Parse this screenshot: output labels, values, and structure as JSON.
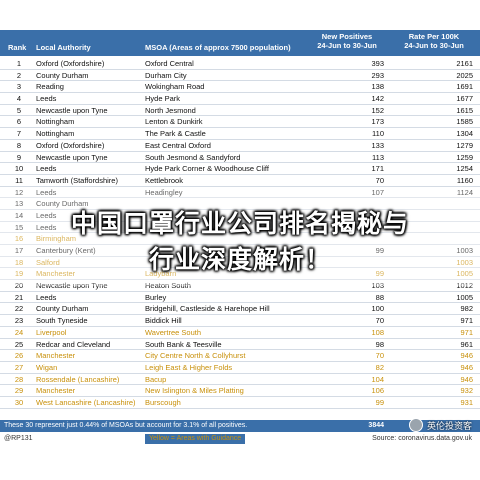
{
  "header": {
    "rank": "Rank",
    "local_authority": "Local Authority",
    "msoa": "MSOA (Areas of approx 7500 population)",
    "new_positives": "New Positives",
    "new_positives_sub": "24-Jun to 30-Jun",
    "rate": "Rate Per 100K",
    "rate_sub": "24-Jun to 30-Jun"
  },
  "rows": [
    {
      "rank": "1",
      "la": "Oxford (Oxfordshire)",
      "msoa": "Oxford Central",
      "np": "393",
      "rate": "2161",
      "style": "normal"
    },
    {
      "rank": "2",
      "la": "County Durham",
      "msoa": "Durham City",
      "np": "293",
      "rate": "2025",
      "style": "normal"
    },
    {
      "rank": "3",
      "la": "Reading",
      "msoa": "Wokingham Road",
      "np": "138",
      "rate": "1691",
      "style": "normal"
    },
    {
      "rank": "4",
      "la": "Leeds",
      "msoa": "Hyde Park",
      "np": "142",
      "rate": "1677",
      "style": "normal"
    },
    {
      "rank": "5",
      "la": "Newcastle upon Tyne",
      "msoa": "North Jesmond",
      "np": "152",
      "rate": "1615",
      "style": "normal"
    },
    {
      "rank": "6",
      "la": "Nottingham",
      "msoa": "Lenton & Dunkirk",
      "np": "173",
      "rate": "1585",
      "style": "normal"
    },
    {
      "rank": "7",
      "la": "Nottingham",
      "msoa": "The Park & Castle",
      "np": "110",
      "rate": "1304",
      "style": "normal"
    },
    {
      "rank": "8",
      "la": "Oxford (Oxfordshire)",
      "msoa": "East Central Oxford",
      "np": "133",
      "rate": "1279",
      "style": "normal"
    },
    {
      "rank": "9",
      "la": "Newcastle upon Tyne",
      "msoa": "South Jesmond & Sandyford",
      "np": "113",
      "rate": "1259",
      "style": "normal"
    },
    {
      "rank": "10",
      "la": "Leeds",
      "msoa": "Hyde Park Corner & Woodhouse Cliff",
      "np": "171",
      "rate": "1254",
      "style": "normal"
    },
    {
      "rank": "11",
      "la": "Tamworth (Staffordshire)",
      "msoa": "Kettlebrook",
      "np": "70",
      "rate": "1160",
      "style": "normal"
    },
    {
      "rank": "12",
      "la": "Leeds",
      "msoa": "Headingley",
      "np": "107",
      "rate": "1124",
      "style": "normal"
    },
    {
      "rank": "13",
      "la": "County Durham",
      "msoa": "",
      "np": "",
      "rate": "",
      "style": "normal"
    },
    {
      "rank": "14",
      "la": "Leeds",
      "msoa": "",
      "np": "",
      "rate": "",
      "style": "normal"
    },
    {
      "rank": "15",
      "la": "Leeds",
      "msoa": "",
      "np": "",
      "rate": "",
      "style": "normal"
    },
    {
      "rank": "16",
      "la": "Birmingham",
      "msoa": "",
      "np": "",
      "rate": "",
      "style": "yellow"
    },
    {
      "rank": "17",
      "la": "Canterbury (Kent)",
      "msoa": "",
      "np": "99",
      "rate": "1003",
      "style": "normal"
    },
    {
      "rank": "18",
      "la": "Salford",
      "msoa": "",
      "np": "",
      "rate": "1003",
      "style": "yellow"
    },
    {
      "rank": "19",
      "la": "Manchester",
      "msoa": "Ladybarn",
      "np": "99",
      "rate": "1005",
      "style": "yellow"
    },
    {
      "rank": "20",
      "la": "Newcastle upon Tyne",
      "msoa": "Heaton South",
      "np": "103",
      "rate": "1012",
      "style": "normal"
    },
    {
      "rank": "21",
      "la": "Leeds",
      "msoa": "Burley",
      "np": "88",
      "rate": "1005",
      "style": "normal"
    },
    {
      "rank": "22",
      "la": "County Durham",
      "msoa": "Bridgehill, Castleside & Harehope Hill",
      "np": "100",
      "rate": "982",
      "style": "normal"
    },
    {
      "rank": "23",
      "la": "South Tyneside",
      "msoa": "Biddick Hill",
      "np": "70",
      "rate": "971",
      "style": "normal"
    },
    {
      "rank": "24",
      "la": "Liverpool",
      "msoa": "Wavertree South",
      "np": "108",
      "rate": "971",
      "style": "yellow"
    },
    {
      "rank": "25",
      "la": "Redcar and Cleveland",
      "msoa": "South Bank & Teesville",
      "np": "98",
      "rate": "961",
      "style": "normal"
    },
    {
      "rank": "26",
      "la": "Manchester",
      "msoa": "City Centre North & Collyhurst",
      "np": "70",
      "rate": "946",
      "style": "yellow"
    },
    {
      "rank": "27",
      "la": "Wigan",
      "msoa": "Leigh East & Higher Folds",
      "np": "82",
      "rate": "946",
      "style": "yellow"
    },
    {
      "rank": "28",
      "la": "Rossendale (Lancashire)",
      "msoa": "Bacup",
      "np": "104",
      "rate": "946",
      "style": "yellow"
    },
    {
      "rank": "29",
      "la": "Manchester",
      "msoa": "New Islington & Miles Platting",
      "np": "106",
      "rate": "932",
      "style": "yellow"
    },
    {
      "rank": "30",
      "la": "West Lancashire (Lancashire)",
      "msoa": "Burscough",
      "np": "99",
      "rate": "931",
      "style": "yellow"
    }
  ],
  "footer": {
    "note": "These 30 represent just 0.44% of MSOAs but account for 3.1% of all positives.",
    "total": "3844"
  },
  "under": {
    "source_left": "@RP131",
    "legend": "Yellow = Areas with Guidance",
    "source_right": "Source: coronavirus.data.gov.uk"
  },
  "headline": {
    "line1": "中国口罩行业公司排名揭秘与",
    "line2": "行业深度解析！"
  },
  "watermark": {
    "text": "英伦投资客"
  },
  "colors": {
    "header_bg": "#3a6fa9",
    "highlight_text": "#c8900a",
    "grid": "#d4dbe4"
  }
}
